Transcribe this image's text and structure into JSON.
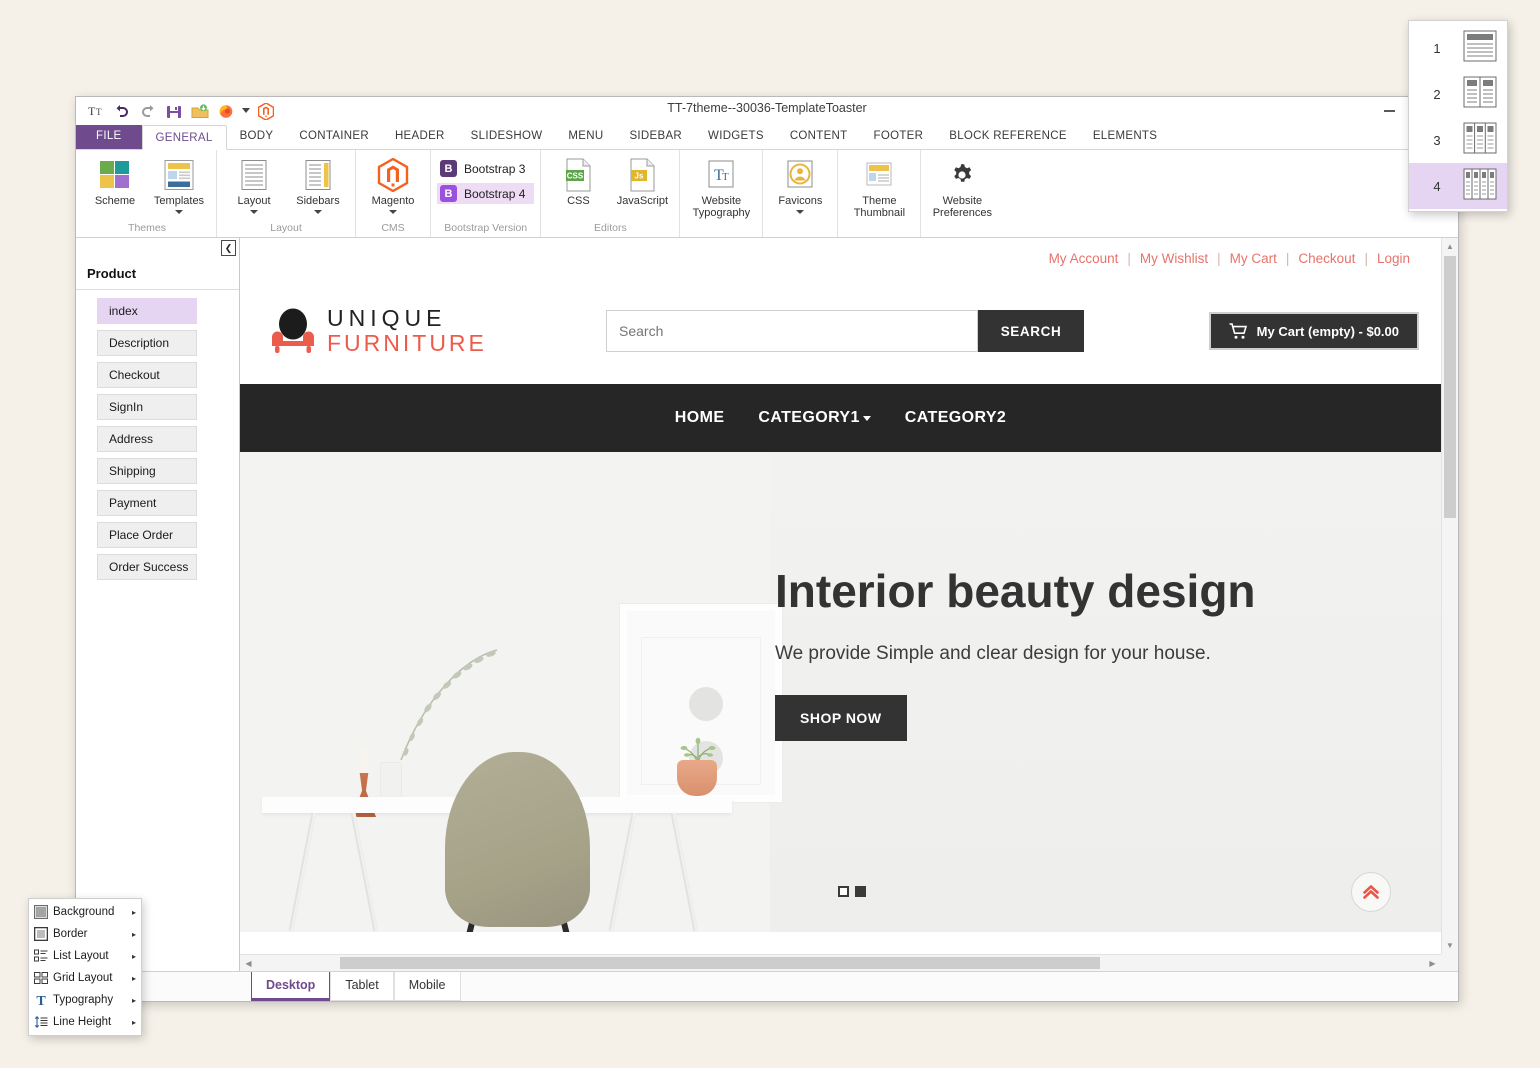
{
  "window": {
    "title": "TT-7theme--30036-TemplateToaster",
    "controls": {
      "minimize": "minimize-icon",
      "maximize": "maximize-icon"
    }
  },
  "quick_access": [
    {
      "name": "typography-icon",
      "glyph": "T"
    },
    {
      "name": "undo-icon",
      "glyph": "undo"
    },
    {
      "name": "redo-icon",
      "glyph": "redo"
    },
    {
      "name": "save-icon",
      "glyph": "save"
    },
    {
      "name": "export-icon",
      "glyph": "export"
    },
    {
      "name": "firefox-preview-icon",
      "glyph": "firefox"
    },
    {
      "name": "preview-dropdown-icon",
      "glyph": "caret"
    },
    {
      "name": "magento-icon",
      "glyph": "magento"
    }
  ],
  "ribbon": {
    "tabs": [
      {
        "label": "FILE",
        "kind": "file"
      },
      {
        "label": "GENERAL",
        "kind": "active"
      },
      {
        "label": "BODY"
      },
      {
        "label": "CONTAINER"
      },
      {
        "label": "HEADER"
      },
      {
        "label": "SLIDESHOW"
      },
      {
        "label": "MENU"
      },
      {
        "label": "SIDEBAR"
      },
      {
        "label": "WIDGETS"
      },
      {
        "label": "CONTENT"
      },
      {
        "label": "FOOTER"
      },
      {
        "label": "BLOCK REFERENCE"
      },
      {
        "label": "ELEMENTS"
      }
    ],
    "groups": [
      {
        "label": "Themes",
        "buttons": [
          {
            "label": "Scheme",
            "icon": "color-scheme-icon",
            "has_caret": false
          },
          {
            "label": "Templates",
            "icon": "templates-icon",
            "has_caret": true
          }
        ]
      },
      {
        "label": "Layout",
        "buttons": [
          {
            "label": "Layout",
            "icon": "layout-icon",
            "has_caret": true
          },
          {
            "label": "Sidebars",
            "icon": "sidebars-icon",
            "has_caret": true
          }
        ]
      },
      {
        "label": "CMS",
        "buttons": [
          {
            "label": "Magento",
            "icon": "magento-icon",
            "has_caret": true
          }
        ]
      },
      {
        "label": "Bootstrap Version",
        "options": [
          {
            "label": "Bootstrap 3",
            "selected": false,
            "badge": "B",
            "badge_color": "#5c3a78"
          },
          {
            "label": "Bootstrap 4",
            "selected": true,
            "badge": "B",
            "badge_color": "#9b51e0"
          }
        ]
      },
      {
        "label": "Editors",
        "buttons": [
          {
            "label": "CSS",
            "icon": "css-file-icon",
            "has_caret": false
          },
          {
            "label": "JavaScript",
            "icon": "js-file-icon",
            "has_caret": false
          }
        ]
      },
      {
        "label": "",
        "buttons": [
          {
            "label": "Website Typography",
            "icon": "website-typography-icon",
            "has_caret": false
          }
        ]
      },
      {
        "label": "",
        "buttons": [
          {
            "label": "Favicons",
            "icon": "favicon-icon",
            "has_caret": true
          }
        ]
      },
      {
        "label": "",
        "buttons": [
          {
            "label": "Theme Thumbnail",
            "icon": "theme-thumbnail-icon",
            "has_caret": false
          }
        ]
      },
      {
        "label": "",
        "buttons": [
          {
            "label": "Website Preferences",
            "icon": "gear-icon",
            "has_caret": false
          }
        ]
      }
    ]
  },
  "left_panel": {
    "collapse_icon": "chevron-left-icon",
    "title": "Product",
    "items": [
      {
        "label": "index",
        "selected": true
      },
      {
        "label": "Description",
        "selected": false
      },
      {
        "label": "Checkout",
        "selected": false
      },
      {
        "label": "SignIn",
        "selected": false
      },
      {
        "label": "Address",
        "selected": false
      },
      {
        "label": "Shipping",
        "selected": false
      },
      {
        "label": "Payment",
        "selected": false
      },
      {
        "label": "Place Order",
        "selected": false
      },
      {
        "label": "Order Success",
        "selected": false
      }
    ]
  },
  "preview": {
    "top_links": [
      {
        "label": "My Account"
      },
      {
        "label": "My Wishlist"
      },
      {
        "label": "My Cart"
      },
      {
        "label": "Checkout"
      },
      {
        "label": "Login"
      }
    ],
    "link_separator": "|",
    "logo": {
      "line1": "UNIQUE",
      "line2": "FURNITURE",
      "icon": "armchair-icon"
    },
    "search": {
      "placeholder": "Search",
      "value": "",
      "button_label": "SEARCH"
    },
    "cart": {
      "label": "My Cart (empty) - $0.00",
      "icon": "shopping-cart-icon"
    },
    "nav": [
      {
        "label": "HOME",
        "has_caret": false
      },
      {
        "label": "CATEGORY1",
        "has_caret": true
      },
      {
        "label": "CATEGORY2",
        "has_caret": false
      }
    ],
    "hero": {
      "heading": "Interior beauty design",
      "subheading": "We provide Simple and clear design for your house.",
      "cta_label": "SHOP NOW",
      "slides": [
        {
          "active": false
        },
        {
          "active": true
        }
      ],
      "image_alt": "white-desk-with-chair-photo"
    },
    "scroll_top_icon": "double-chevron-up-icon"
  },
  "device_tabs": [
    {
      "label": "Desktop",
      "active": true
    },
    {
      "label": "Tablet",
      "active": false
    },
    {
      "label": "Mobile",
      "active": false
    }
  ],
  "column_dropdown": {
    "options": [
      {
        "label": "1",
        "icon": "one-column-icon",
        "selected": false
      },
      {
        "label": "2",
        "icon": "two-column-icon",
        "selected": false
      },
      {
        "label": "3",
        "icon": "three-column-icon",
        "selected": false
      },
      {
        "label": "4",
        "icon": "four-column-icon",
        "selected": true
      }
    ]
  },
  "context_menu": {
    "items": [
      {
        "label": "Background",
        "icon": "background-icon",
        "arrow": "▸"
      },
      {
        "label": "Border",
        "icon": "border-icon",
        "arrow": "▸"
      },
      {
        "label": "List Layout",
        "icon": "list-layout-icon",
        "arrow": "▸"
      },
      {
        "label": "Grid Layout",
        "icon": "grid-layout-icon",
        "arrow": "▸"
      },
      {
        "label": "Typography",
        "icon": "typography-icon",
        "arrow": "▸"
      },
      {
        "label": "Line Height",
        "icon": "line-height-icon",
        "arrow": "▸"
      }
    ]
  },
  "colors": {
    "accent_purple": "#6f4b8e",
    "selection_purple": "#e6d5f2",
    "brand_red": "#ec5c4d",
    "site_dark": "#333333"
  }
}
